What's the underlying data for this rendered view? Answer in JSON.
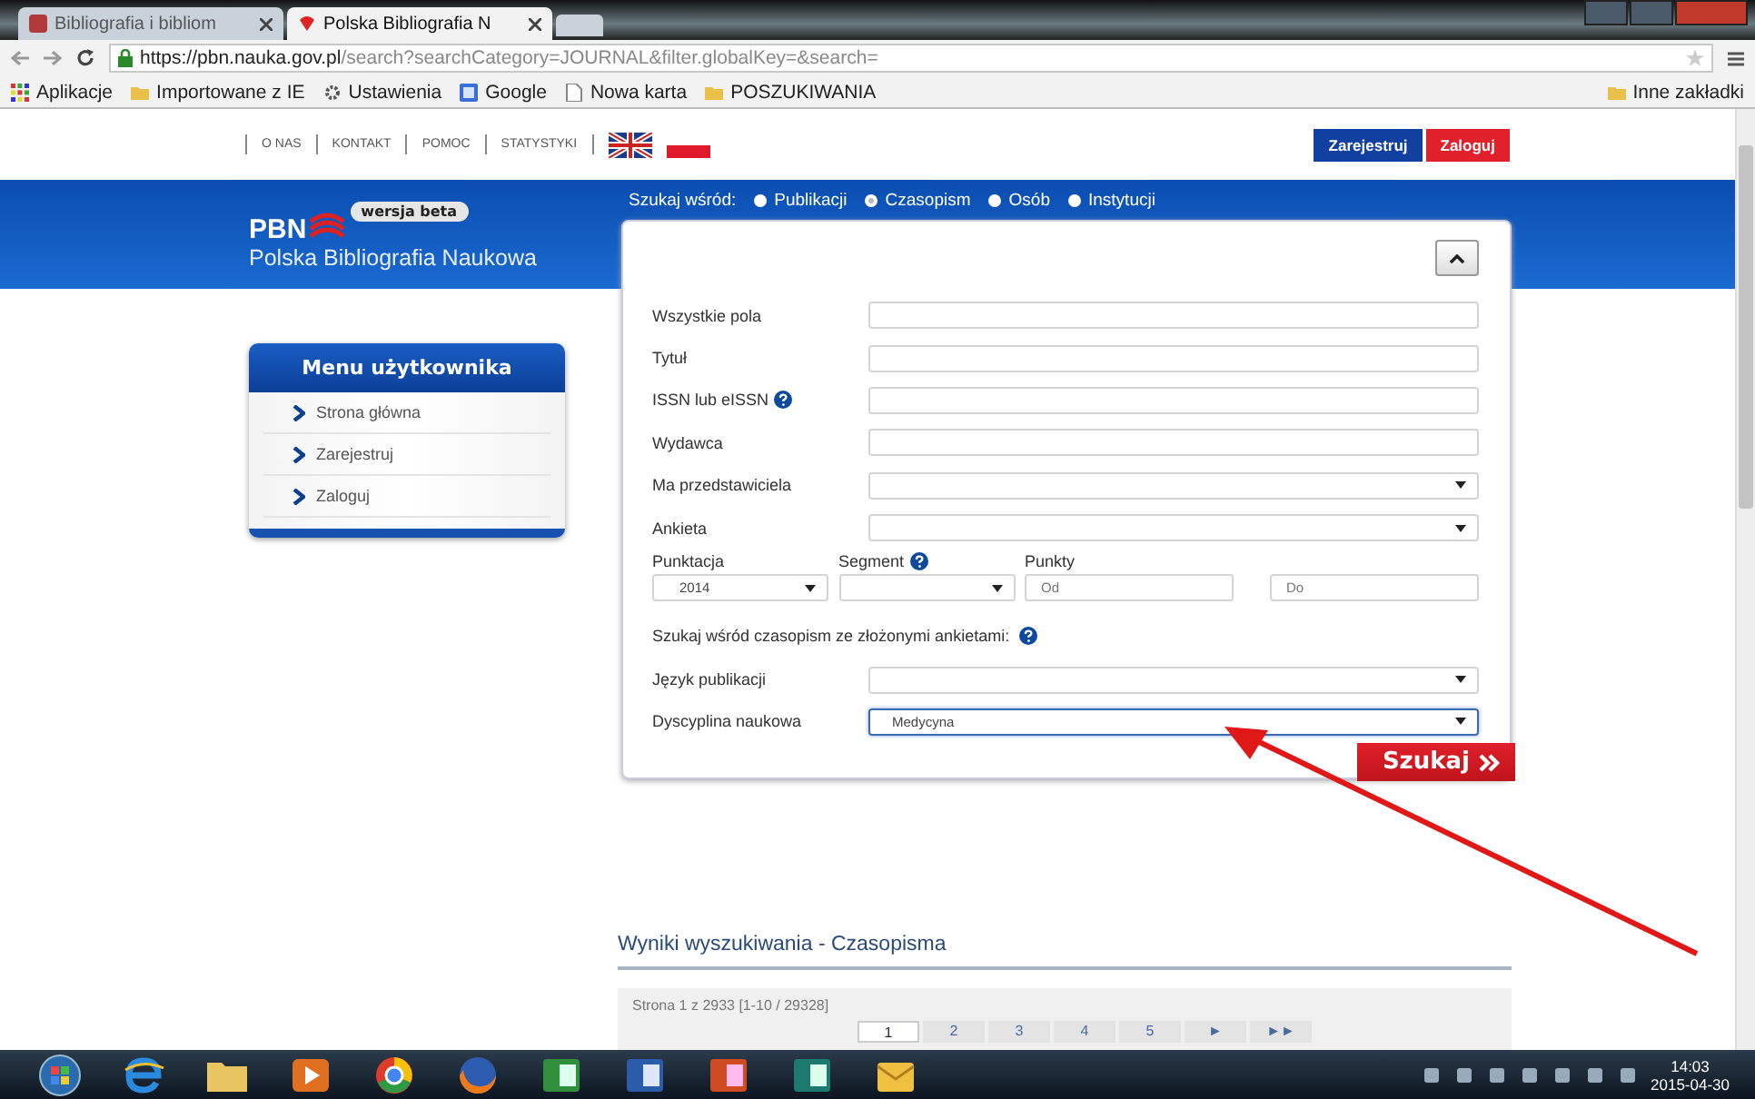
{
  "browser": {
    "tabs": [
      {
        "title": "Bibliografia i bibliom",
        "selected": false
      },
      {
        "title": "Polska Bibliografia N",
        "selected": true
      }
    ],
    "address": {
      "host": "https://pbn.nauka.gov.pl",
      "path": "/search?searchCategory=JOURNAL&filter.globalKey=&search="
    },
    "bookmarks": [
      {
        "label": "Aplikacje",
        "kind": "apps"
      },
      {
        "label": "Importowane z IE",
        "kind": "folder"
      },
      {
        "label": "Ustawienia",
        "kind": "gear"
      },
      {
        "label": "Google",
        "kind": "google"
      },
      {
        "label": "Nowa karta",
        "kind": "page"
      },
      {
        "label": "POSZUKIWANIA",
        "kind": "folder"
      }
    ],
    "other_bookmarks": "Inne zakładki"
  },
  "page": {
    "top_links": [
      "O NAS",
      "KONTAKT",
      "POMOC",
      "STATYSTYKI"
    ],
    "account_buttons": [
      {
        "label": "Zarejestruj",
        "kind": "register"
      },
      {
        "label": "Zaloguj",
        "kind": "login"
      }
    ],
    "logo": {
      "abbr": "PBN",
      "name": "Polska Bibliografia Naukowa",
      "badge": "wersja beta"
    },
    "search_scope": {
      "label": "Szukaj wśród:",
      "options": [
        {
          "label": "Publikacji",
          "selected": false
        },
        {
          "label": "Czasopism",
          "selected": true
        },
        {
          "label": "Osób",
          "selected": false
        },
        {
          "label": "Instytucji",
          "selected": false
        }
      ]
    },
    "user_menu": {
      "title": "Menu użytkownika",
      "items": [
        "Strona główna",
        "Zarejestruj",
        "Zaloguj"
      ]
    },
    "form": {
      "fields": [
        {
          "label": "Wszystkie pola",
          "kind": "text",
          "help": false
        },
        {
          "label": "Tytuł",
          "kind": "text",
          "help": false
        },
        {
          "label": "ISSN lub eISSN",
          "kind": "text",
          "help": true
        },
        {
          "label": "Wydawca",
          "kind": "text",
          "help": false
        },
        {
          "label": "Ma przedstawiciela",
          "kind": "select",
          "help": false
        },
        {
          "label": "Ankieta",
          "kind": "select",
          "help": false
        }
      ],
      "scoring": {
        "year_label": "Punktacja",
        "year_value": "2014",
        "segment_label": "Segment",
        "segment_help": true,
        "points_label": "Punkty",
        "points_from": {
          "placeholder": "Od"
        },
        "points_to": {
          "placeholder": "Do"
        }
      },
      "completed_note": {
        "text": "Szukaj wśród czasopism ze złożonymi ankietami:",
        "help": true
      },
      "extra_fields": [
        {
          "label": "Język publikacji",
          "kind": "select",
          "focused": false
        },
        {
          "label": "Dyscyplina naukowa",
          "kind": "select",
          "value": "Medycyna",
          "focused": true
        }
      ],
      "search_button": "Szukaj"
    },
    "results": {
      "heading": "Wyniki wyszukiwania - Czasopisma",
      "summary": "Strona 1 z 2933 [1-10 / 29328]",
      "pages": [
        {
          "label": "1",
          "selected": true
        },
        {
          "label": "2",
          "selected": false
        },
        {
          "label": "3",
          "selected": false
        },
        {
          "label": "4",
          "selected": false
        },
        {
          "label": "5",
          "selected": false
        },
        {
          "label": "►",
          "selected": false
        },
        {
          "label": "►►",
          "selected": false
        }
      ]
    }
  },
  "taskbar": {
    "time": "14:03",
    "date": "2015-04-30"
  }
}
